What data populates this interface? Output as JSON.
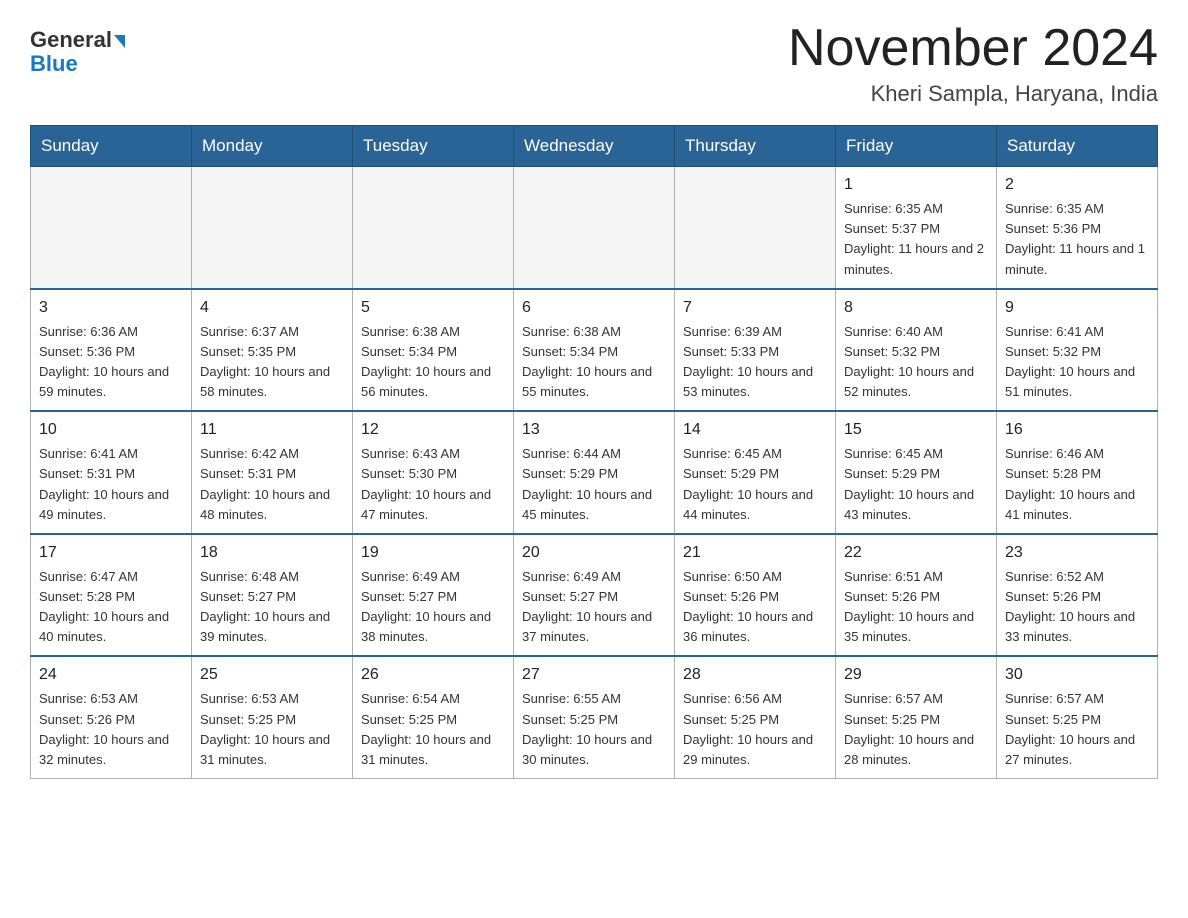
{
  "logo": {
    "text1": "General",
    "text2": "Blue"
  },
  "title": "November 2024",
  "subtitle": "Kheri Sampla, Haryana, India",
  "days_of_week": [
    "Sunday",
    "Monday",
    "Tuesday",
    "Wednesday",
    "Thursday",
    "Friday",
    "Saturday"
  ],
  "weeks": [
    [
      {
        "day": "",
        "info": ""
      },
      {
        "day": "",
        "info": ""
      },
      {
        "day": "",
        "info": ""
      },
      {
        "day": "",
        "info": ""
      },
      {
        "day": "",
        "info": ""
      },
      {
        "day": "1",
        "info": "Sunrise: 6:35 AM\nSunset: 5:37 PM\nDaylight: 11 hours and 2 minutes."
      },
      {
        "day": "2",
        "info": "Sunrise: 6:35 AM\nSunset: 5:36 PM\nDaylight: 11 hours and 1 minute."
      }
    ],
    [
      {
        "day": "3",
        "info": "Sunrise: 6:36 AM\nSunset: 5:36 PM\nDaylight: 10 hours and 59 minutes."
      },
      {
        "day": "4",
        "info": "Sunrise: 6:37 AM\nSunset: 5:35 PM\nDaylight: 10 hours and 58 minutes."
      },
      {
        "day": "5",
        "info": "Sunrise: 6:38 AM\nSunset: 5:34 PM\nDaylight: 10 hours and 56 minutes."
      },
      {
        "day": "6",
        "info": "Sunrise: 6:38 AM\nSunset: 5:34 PM\nDaylight: 10 hours and 55 minutes."
      },
      {
        "day": "7",
        "info": "Sunrise: 6:39 AM\nSunset: 5:33 PM\nDaylight: 10 hours and 53 minutes."
      },
      {
        "day": "8",
        "info": "Sunrise: 6:40 AM\nSunset: 5:32 PM\nDaylight: 10 hours and 52 minutes."
      },
      {
        "day": "9",
        "info": "Sunrise: 6:41 AM\nSunset: 5:32 PM\nDaylight: 10 hours and 51 minutes."
      }
    ],
    [
      {
        "day": "10",
        "info": "Sunrise: 6:41 AM\nSunset: 5:31 PM\nDaylight: 10 hours and 49 minutes."
      },
      {
        "day": "11",
        "info": "Sunrise: 6:42 AM\nSunset: 5:31 PM\nDaylight: 10 hours and 48 minutes."
      },
      {
        "day": "12",
        "info": "Sunrise: 6:43 AM\nSunset: 5:30 PM\nDaylight: 10 hours and 47 minutes."
      },
      {
        "day": "13",
        "info": "Sunrise: 6:44 AM\nSunset: 5:29 PM\nDaylight: 10 hours and 45 minutes."
      },
      {
        "day": "14",
        "info": "Sunrise: 6:45 AM\nSunset: 5:29 PM\nDaylight: 10 hours and 44 minutes."
      },
      {
        "day": "15",
        "info": "Sunrise: 6:45 AM\nSunset: 5:29 PM\nDaylight: 10 hours and 43 minutes."
      },
      {
        "day": "16",
        "info": "Sunrise: 6:46 AM\nSunset: 5:28 PM\nDaylight: 10 hours and 41 minutes."
      }
    ],
    [
      {
        "day": "17",
        "info": "Sunrise: 6:47 AM\nSunset: 5:28 PM\nDaylight: 10 hours and 40 minutes."
      },
      {
        "day": "18",
        "info": "Sunrise: 6:48 AM\nSunset: 5:27 PM\nDaylight: 10 hours and 39 minutes."
      },
      {
        "day": "19",
        "info": "Sunrise: 6:49 AM\nSunset: 5:27 PM\nDaylight: 10 hours and 38 minutes."
      },
      {
        "day": "20",
        "info": "Sunrise: 6:49 AM\nSunset: 5:27 PM\nDaylight: 10 hours and 37 minutes."
      },
      {
        "day": "21",
        "info": "Sunrise: 6:50 AM\nSunset: 5:26 PM\nDaylight: 10 hours and 36 minutes."
      },
      {
        "day": "22",
        "info": "Sunrise: 6:51 AM\nSunset: 5:26 PM\nDaylight: 10 hours and 35 minutes."
      },
      {
        "day": "23",
        "info": "Sunrise: 6:52 AM\nSunset: 5:26 PM\nDaylight: 10 hours and 33 minutes."
      }
    ],
    [
      {
        "day": "24",
        "info": "Sunrise: 6:53 AM\nSunset: 5:26 PM\nDaylight: 10 hours and 32 minutes."
      },
      {
        "day": "25",
        "info": "Sunrise: 6:53 AM\nSunset: 5:25 PM\nDaylight: 10 hours and 31 minutes."
      },
      {
        "day": "26",
        "info": "Sunrise: 6:54 AM\nSunset: 5:25 PM\nDaylight: 10 hours and 31 minutes."
      },
      {
        "day": "27",
        "info": "Sunrise: 6:55 AM\nSunset: 5:25 PM\nDaylight: 10 hours and 30 minutes."
      },
      {
        "day": "28",
        "info": "Sunrise: 6:56 AM\nSunset: 5:25 PM\nDaylight: 10 hours and 29 minutes."
      },
      {
        "day": "29",
        "info": "Sunrise: 6:57 AM\nSunset: 5:25 PM\nDaylight: 10 hours and 28 minutes."
      },
      {
        "day": "30",
        "info": "Sunrise: 6:57 AM\nSunset: 5:25 PM\nDaylight: 10 hours and 27 minutes."
      }
    ]
  ]
}
